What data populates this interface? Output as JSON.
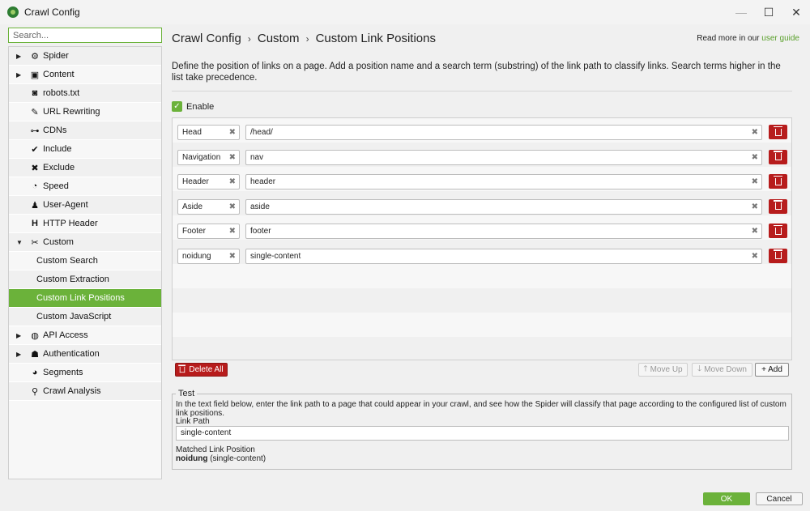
{
  "window": {
    "title": "Crawl Config",
    "minimize_icon": "minimize-icon",
    "maximize_icon": "maximize-icon",
    "close_icon": "close-icon"
  },
  "sidebar": {
    "search_placeholder": "Search...",
    "items": [
      {
        "label": "Spider",
        "icon": "gear-icon",
        "expandable": true
      },
      {
        "label": "Content",
        "icon": "content-icon",
        "expandable": true
      },
      {
        "label": "robots.txt",
        "icon": "robot-icon"
      },
      {
        "label": "URL Rewriting",
        "icon": "edit-icon"
      },
      {
        "label": "CDNs",
        "icon": "network-icon"
      },
      {
        "label": "Include",
        "icon": "check-circle-icon"
      },
      {
        "label": "Exclude",
        "icon": "x-circle-icon"
      },
      {
        "label": "Speed",
        "icon": "speedometer-icon"
      },
      {
        "label": "User-Agent",
        "icon": "user-agent-icon"
      },
      {
        "label": "HTTP Header",
        "icon": "header-icon"
      },
      {
        "label": "Custom",
        "icon": "tools-icon",
        "expanded": true
      },
      {
        "label": "Custom Search",
        "child": true
      },
      {
        "label": "Custom Extraction",
        "child": true
      },
      {
        "label": "Custom Link Positions",
        "child": true,
        "selected": true
      },
      {
        "label": "Custom JavaScript",
        "child": true
      },
      {
        "label": "API Access",
        "icon": "globe-icon",
        "expandable": true
      },
      {
        "label": "Authentication",
        "icon": "users-icon",
        "expandable": true
      },
      {
        "label": "Segments",
        "icon": "pie-chart-icon"
      },
      {
        "label": "Crawl Analysis",
        "icon": "search-icon"
      }
    ]
  },
  "breadcrumb": {
    "part1": "Crawl Config",
    "part2": "Custom",
    "part3": "Custom Link Positions",
    "separator": "›"
  },
  "help": {
    "prefix": "Read more in our",
    "link": "user guide"
  },
  "description": "Define the position of links on a page. Add a position name and a search term (substring) of the link path to classify links. Search terms higher in the list take precedence.",
  "enable": {
    "label": "Enable",
    "checked": true
  },
  "positions": [
    {
      "name": "Head",
      "term": "/head/"
    },
    {
      "name": "Navigation",
      "term": "nav"
    },
    {
      "name": "Header",
      "term": "header"
    },
    {
      "name": "Aside",
      "term": "aside"
    },
    {
      "name": "Footer",
      "term": "footer"
    },
    {
      "name": "noidung",
      "term": "single-content"
    }
  ],
  "actions": {
    "delete_all": "Delete All",
    "move_up": "Move Up",
    "move_down": "Move Down",
    "add": "+ Add"
  },
  "test": {
    "legend": "Test",
    "description": "In the text field below, enter the link path to a page that could appear in your crawl, and see how the Spider will classify that page according to the configured list of custom link positions.",
    "link_path_label": "Link Path",
    "link_path_value": "single-content",
    "matched_label": "Matched Link Position",
    "matched_name": "noidung",
    "matched_term": "(single-content)"
  },
  "footer": {
    "ok": "OK",
    "cancel": "Cancel"
  },
  "colors": {
    "accent": "#6bb23a",
    "danger": "#b71c1c"
  }
}
